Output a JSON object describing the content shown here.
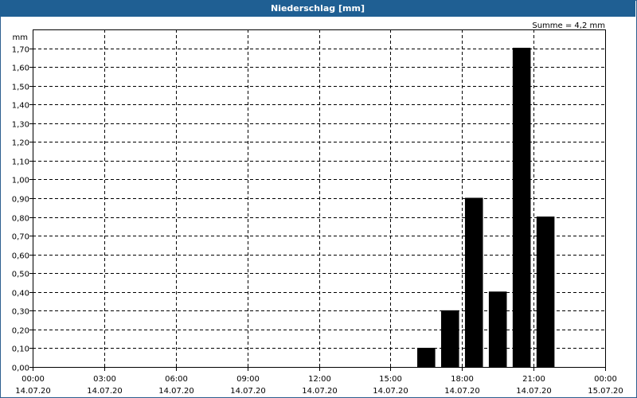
{
  "chart_data": {
    "type": "bar",
    "title": "Niederschlag [mm]",
    "ylabel": "mm",
    "sum_label": "Summe = 4,2 mm",
    "ylim": [
      0,
      1.8
    ],
    "y_ticks": [
      0,
      0.1,
      0.2,
      0.3,
      0.4,
      0.5,
      0.6,
      0.7,
      0.8,
      0.9,
      1.0,
      1.1,
      1.2,
      1.3,
      1.4,
      1.5,
      1.6,
      1.7
    ],
    "y_tick_labels": [
      "0,00",
      "0,10",
      "0,20",
      "0,30",
      "0,40",
      "0,50",
      "0,60",
      "0,70",
      "0,80",
      "0,90",
      "1,00",
      "1,10",
      "1,20",
      "1,30",
      "1,40",
      "1,50",
      "1,60",
      "1,70"
    ],
    "x_range_hours": [
      0,
      24
    ],
    "x_ticks": [
      {
        "time": "00:00",
        "date": "14.07.20"
      },
      {
        "time": "03:00",
        "date": "14.07.20"
      },
      {
        "time": "06:00",
        "date": "14.07.20"
      },
      {
        "time": "09:00",
        "date": "14.07.20"
      },
      {
        "time": "12:00",
        "date": "14.07.20"
      },
      {
        "time": "15:00",
        "date": "14.07.20"
      },
      {
        "time": "18:00",
        "date": "14.07.20"
      },
      {
        "time": "21:00",
        "date": "14.07.20"
      },
      {
        "time": "00:00",
        "date": "15.07.20"
      }
    ],
    "bars": [
      {
        "start": "16:00",
        "end": "17:00",
        "value": 0.1
      },
      {
        "start": "17:00",
        "end": "18:00",
        "value": 0.3
      },
      {
        "start": "18:00",
        "end": "19:00",
        "value": 0.9
      },
      {
        "start": "19:00",
        "end": "20:00",
        "value": 0.4
      },
      {
        "start": "20:00",
        "end": "21:00",
        "value": 1.7
      },
      {
        "start": "21:00",
        "end": "22:00",
        "value": 0.8
      }
    ],
    "grid": true,
    "bar_color": "#000000"
  }
}
